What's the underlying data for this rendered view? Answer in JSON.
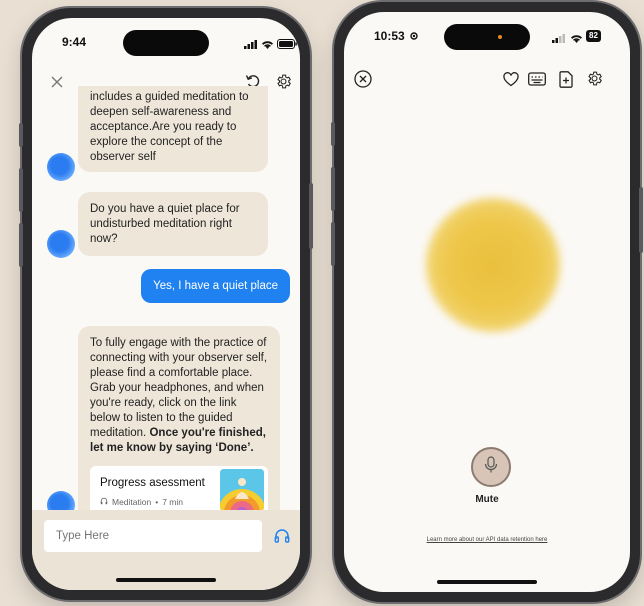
{
  "left_phone": {
    "status": {
      "time": "9:44"
    },
    "toolbar": {
      "close_icon": "close-icon",
      "refresh_icon": "refresh-icon",
      "settings_icon": "gear-icon"
    },
    "messages": [
      {
        "role": "bot",
        "text": "includes a guided meditation to deepen self-awareness and acceptance.Are you ready to explore the concept of the observer self"
      },
      {
        "role": "bot",
        "text": "Do you have a quiet place for undisturbed meditation right now?"
      },
      {
        "role": "user",
        "text": "Yes, I have a quiet place"
      },
      {
        "role": "bot",
        "text": "To fully engage with the practice of connecting with your observer self, please find a comfortable place. Grab your headphones, and when you're ready, click on the link below to listen to the guided meditation.",
        "bold": "Once you're finished, let me know by saying ‘Done’."
      }
    ],
    "card": {
      "title": "Progress asessment",
      "type": "Meditation",
      "sep": "•",
      "duration": "7 min"
    },
    "composer": {
      "placeholder": "Type Here",
      "headphones_icon": "headphones-icon"
    }
  },
  "right_phone": {
    "status": {
      "time": "10:53",
      "battery": "82"
    },
    "toolbar": {
      "close_icon": "close-circle-icon",
      "heart_icon": "heart-icon",
      "keyboard_icon": "keyboard-icon",
      "add_doc_icon": "add-document-icon",
      "settings_icon": "gear-icon"
    },
    "mute_label": "Mute",
    "retention_note": "Learn more about our API data retention here",
    "colors": {
      "orb": "#eec74a",
      "accent": "#1f82f0"
    }
  }
}
